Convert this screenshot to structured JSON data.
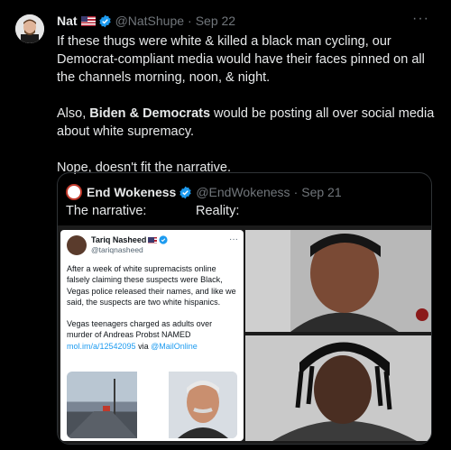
{
  "tweet": {
    "author_name": "Nat",
    "author_handle": "@NatShupe",
    "separator": "·",
    "date": "Sep 22",
    "more_label": "···",
    "paragraph1": "If these thugs were white & killed a black man cycling, our Democrat-compliant media would have their faces pinned on all the channels morning, noon, & night.",
    "paragraph2_prefix": "Also, ",
    "paragraph2_bold": "Biden & Democrats",
    "paragraph2_suffix": " would be posting all over social media about white supremacy.",
    "paragraph3": "Nope, doesn't fit the narrative."
  },
  "quote": {
    "author_name": "End Wokeness",
    "author_handle": "@EndWokeness",
    "separator": "·",
    "date": "Sep 21",
    "label_left": "The narrative:",
    "label_right": "Reality:",
    "embedded": {
      "author_name": "Tariq Nasheed",
      "author_handle": "@tariqnasheed",
      "more_label": "···",
      "paragraph1": "After a week of white supremacists online falsely claiming these suspects were Black, Vegas police released their names, and like we said, the suspects are two white hispanics.",
      "paragraph2_text": "Vegas teenagers charged as adults over murder of Andreas Probst NAMED ",
      "paragraph2_link": "mol.im/a/12542095",
      "paragraph2_via": " via ",
      "paragraph2_mention": "@MailOnline"
    }
  },
  "colors": {
    "background": "#000000",
    "text": "#e7e9ea",
    "muted": "#71767b",
    "verified": "#1d9bf0",
    "border": "#2f3336"
  }
}
